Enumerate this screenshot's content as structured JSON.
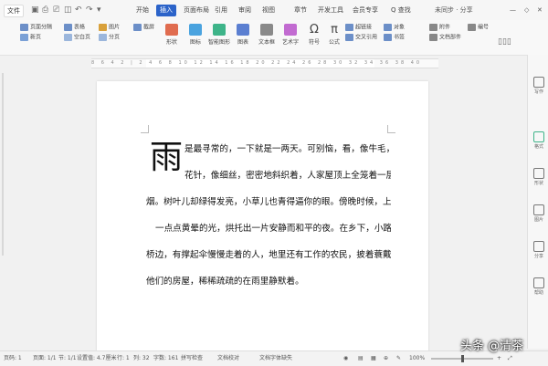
{
  "titlebar": {
    "app_menu": "文件",
    "tabs": [
      {
        "label": "开始",
        "active": false
      },
      {
        "label": "插入",
        "active": true
      },
      {
        "label": "页面布局",
        "active": false
      },
      {
        "label": "引用",
        "active": false
      },
      {
        "label": "审阅",
        "active": false
      },
      {
        "label": "视图",
        "active": false
      },
      {
        "label": "章节",
        "active": false
      },
      {
        "label": "开发工具",
        "active": false
      },
      {
        "label": "会员专享",
        "active": false
      }
    ],
    "search_label": "Q 查找",
    "right_text": "未同步 · 分享"
  },
  "ribbon": {
    "row1": [
      "页面分隔",
      "表格",
      "图片",
      "截屏",
      "形状",
      "图标",
      "智能图形",
      "图表",
      "文本框",
      "艺术字",
      "符号",
      "公式",
      "超链接",
      "交叉引用",
      "对象",
      "书签"
    ],
    "row2": [
      "新页",
      "空白页",
      "分页",
      "封面页",
      "水印",
      "批注",
      "页眉页脚",
      "页码",
      "日期",
      "附件",
      "文档部件",
      "编号"
    ]
  },
  "ruler": {
    "ticks": "8 6 4 2 | 2 4 6 8 10 12 14 16 18 20 22 24 26 28 30 32 34 36 38 40"
  },
  "document": {
    "drop_cap": "雨",
    "lines": [
      "是最寻常的，一下就是一两天。可别恼，看，像牛毛，像",
      "花针，像细丝，密密地斜织着，人家屋顶上全笼着一层薄",
      "烟。树叶儿却绿得发亮，小草儿也青得逼你的眼。傍晚时候，上灯了，",
      "一点点黄晕的光，烘托出一片安静而和平的夜。在乡下，小路上，石",
      "桥边，有撑起伞慢慢走着的人，地里还有工作的农民，披着蓑戴着笠。",
      "他们的房屋，稀稀疏疏的在雨里静默着。"
    ]
  },
  "sidebar": {
    "items": [
      "写作",
      "格式",
      "形状",
      "图片",
      "分享",
      "帮助"
    ]
  },
  "statusbar": {
    "page": "页码: 1",
    "pages": "页面: 1/1",
    "section": "节: 1/1",
    "setting": "设置值: 4.7厘米",
    "row": "行: 1",
    "column": "列: 32",
    "words": "字数: 161",
    "spell": "拼写检查",
    "proof": "文档校对",
    "missing_font": "文档字体缺失",
    "zoom": "100%"
  },
  "watermark": "头条 @清茶"
}
